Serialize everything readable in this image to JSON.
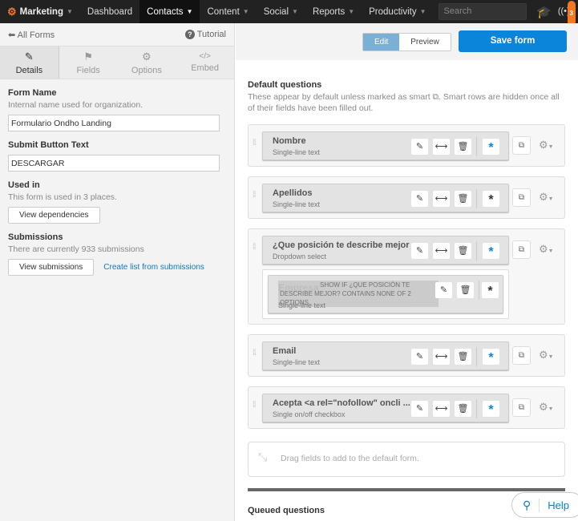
{
  "nav": {
    "items": [
      "Marketing",
      "Dashboard",
      "Contacts",
      "Content",
      "Social",
      "Reports",
      "Productivity"
    ],
    "search_placeholder": "Search",
    "notifications": "3"
  },
  "left": {
    "back": "All Forms",
    "tutorial": "Tutorial",
    "tabs": [
      "Details",
      "Fields",
      "Options",
      "Embed"
    ],
    "form_name_label": "Form Name",
    "form_name_help": "Internal name used for organization.",
    "form_name_value": "Formulario Ondho Landing",
    "submit_label": "Submit Button Text",
    "submit_value": "DESCARGAR",
    "used_label": "Used in",
    "used_text": "This form is used in 3 places.",
    "view_deps": "View dependencies",
    "subs_label": "Submissions",
    "subs_text": "There are currently 933 submissions",
    "view_subs": "View submissions",
    "create_list": "Create list from submissions"
  },
  "right": {
    "edit": "Edit",
    "preview": "Preview",
    "save": "Save form",
    "default_title": "Default questions",
    "default_desc": "These appear by default unless marked as smart ⧉. Smart rows are hidden once all of their fields have been filled out.",
    "fields": [
      {
        "name": "Nombre",
        "type": "Single-line text",
        "required": true
      },
      {
        "name": "Apellidos",
        "type": "Single-line text",
        "required": false
      },
      {
        "name": "¿Que posición te describe mejor",
        "type": "Dropdown select",
        "required": true
      },
      {
        "name": "Email",
        "type": "Single-line text",
        "required": true
      },
      {
        "name": "Acepta <a rel=\"nofollow\" oncli ...",
        "type": "Single on/off checkbox",
        "required": true
      }
    ],
    "dependent": {
      "name": "Empresa",
      "condition": "SHOW IF ¿QUE POSICIÓN TE DESCRIBE MEJOR? CONTAINS NONE OF 2 OPTIONS",
      "type": "Single-line text"
    },
    "drop_text": "Drag fields to add to the default form.",
    "queued_title": "Queued questions",
    "help": "Help"
  },
  "colors": {
    "accent": "#0a85d9",
    "brand": "#f57722"
  }
}
